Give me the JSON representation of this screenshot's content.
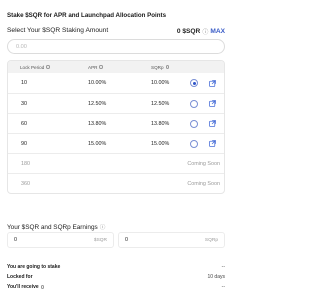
{
  "title": "Stake $SQR for APR and Launchpad Allocation Points",
  "stake": {
    "label": "Select Your $SQR Staking Amount",
    "balance": "0 $SQR",
    "info_icon": "info-icon",
    "max_label": "MAX",
    "input_placeholder": "0.00",
    "input_value": ""
  },
  "table": {
    "headers": [
      "Lock Period",
      "APR",
      "SQRp"
    ],
    "rows": [
      {
        "period": "10",
        "apr": "10.00%",
        "sqrp": "10.00%",
        "selected": true,
        "available": true
      },
      {
        "period": "30",
        "apr": "12.50%",
        "sqrp": "12.50%",
        "selected": false,
        "available": true
      },
      {
        "period": "60",
        "apr": "13.80%",
        "sqrp": "13.80%",
        "selected": false,
        "available": true
      },
      {
        "period": "90",
        "apr": "15.00%",
        "sqrp": "15.00%",
        "selected": false,
        "available": true
      },
      {
        "period": "180",
        "status": "Coming Soon",
        "available": false
      },
      {
        "period": "360",
        "status": "Coming Soon",
        "available": false
      }
    ]
  },
  "earnings": {
    "title": "Your $SQR and SQRp Earnings",
    "sqr_value": "0",
    "sqr_unit": "$SQR",
    "sqrp_value": "0",
    "sqrp_unit": "SQRp"
  },
  "summary": [
    {
      "label": "You are going to stake",
      "value": "--"
    },
    {
      "label": "Locked for",
      "value": "10 days"
    },
    {
      "label": "You'll receive",
      "value": "--"
    }
  ],
  "colors": {
    "accent": "#2f55c9",
    "muted": "#9a9a9a",
    "header_bg": "#f2f2f2"
  }
}
